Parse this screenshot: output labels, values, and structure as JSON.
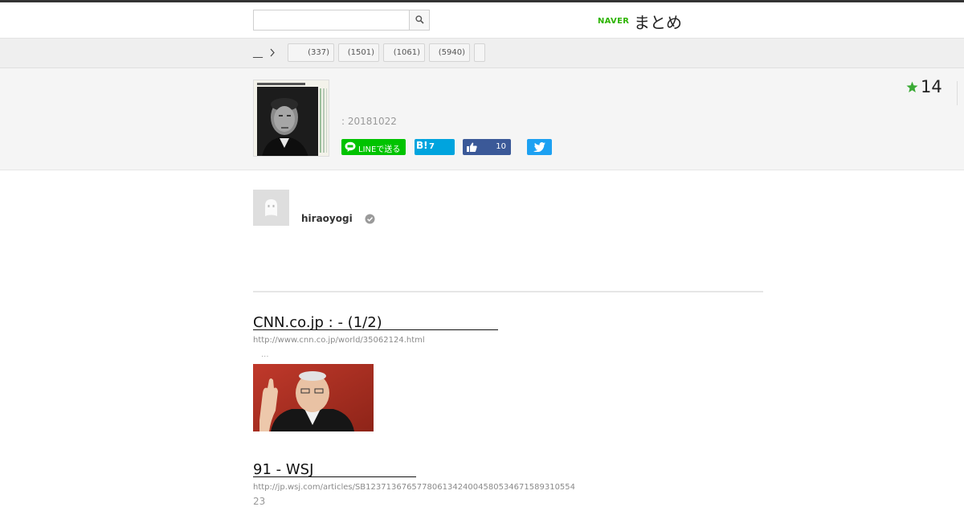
{
  "header": {
    "search": {
      "value": "",
      "placeholder": ""
    },
    "logo": {
      "brand": "NAVER",
      "service": "まとめ",
      "brand_color": "#2db400"
    }
  },
  "breadcrumb": {
    "root_label": "__",
    "tags": [
      {
        "label": "(337)"
      },
      {
        "label": "(1501)"
      },
      {
        "label": "(1061)"
      },
      {
        "label": "(5940)"
      },
      {
        "label": ""
      }
    ]
  },
  "summary": {
    "date": ": 20181022",
    "favorite_count": "14",
    "accent_color": "#3aaa35",
    "share": {
      "line_label": "LINEで送る",
      "hatena_label": "B!",
      "hatena_count": "7",
      "facebook_count": "10",
      "twitter_icon": "twitter-bird-icon"
    }
  },
  "author": {
    "name": "hiraoyogi",
    "verified_icon": "check-circle-icon"
  },
  "links": [
    {
      "title": "CNN.co.jp :  - (1/2)",
      "url": "http://www.cnn.co.jp/world/35062124.html",
      "excerpt": "..."
    },
    {
      "title": "91 - WSJ",
      "url": "http://jp.wsj.com/articles/SB12371367657780613424004580534671589310554",
      "excerpt": "23"
    }
  ]
}
